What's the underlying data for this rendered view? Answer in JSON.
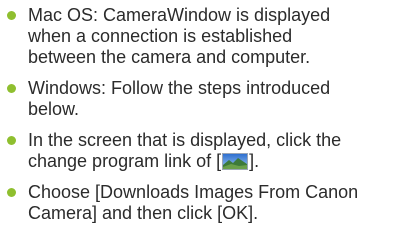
{
  "colors": {
    "bullet": "#8fbf2f",
    "text": "#2b2b2b"
  },
  "items": [
    {
      "lines": [
        "Mac OS: CameraWindow is displayed",
        "when a connection is established",
        "between the camera and computer."
      ]
    },
    {
      "lines": [
        "Windows: Follow the steps introduced",
        "below."
      ]
    },
    {
      "line1": "In the screen that is displayed, click the",
      "line2_before": "change program link of [",
      "icon": "change-program-icon",
      "line2_after": "]."
    },
    {
      "lines": [
        "Choose [Downloads Images From Canon",
        "Camera] and then click [OK]."
      ]
    }
  ]
}
